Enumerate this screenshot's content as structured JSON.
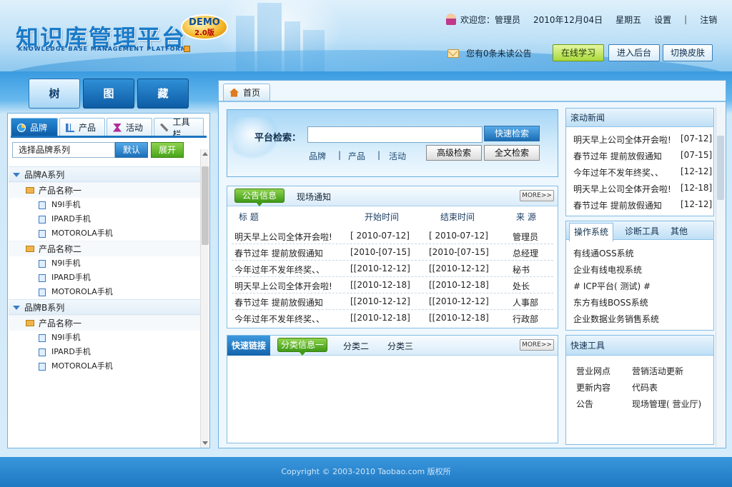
{
  "header": {
    "logo_title": "知识库管理平台",
    "logo_subtitle": "KNOWLEDGE BASE MANAGEMENT PLATFORM",
    "badge_demo": "DEMO",
    "badge_version": "2.0版",
    "welcome": "欢迎您：管理员",
    "date": "2010年12月04日",
    "weekday": "星期五",
    "settings": "设置",
    "separator": "|",
    "logout": "注销",
    "notice": "您有0条未读公告",
    "btn_learn": "在线学习",
    "btn_admin": "进入后台",
    "btn_skin": "切换皮肤"
  },
  "left": {
    "big_tabs": [
      "树",
      "图",
      "藏"
    ],
    "sub_tabs": [
      "品牌",
      "产品",
      "活动",
      "工具栏"
    ],
    "brand_select": "选择品牌系列",
    "btn_default": "默认",
    "btn_expand": "展开",
    "tree": [
      {
        "kind": "group",
        "label": "品牌A系列"
      },
      {
        "kind": "folder",
        "label": "产品名称一"
      },
      {
        "kind": "item",
        "label": "N9I手机"
      },
      {
        "kind": "item",
        "label": "IPARD手机"
      },
      {
        "kind": "item",
        "label": "MOTOROLA手机"
      },
      {
        "kind": "folder",
        "label": "产品名称二"
      },
      {
        "kind": "item",
        "label": "N9I手机"
      },
      {
        "kind": "item",
        "label": "IPARD手机"
      },
      {
        "kind": "item",
        "label": "MOTOROLA手机"
      },
      {
        "kind": "group",
        "label": "品牌B系列"
      },
      {
        "kind": "folder",
        "label": "产品名称一"
      },
      {
        "kind": "item",
        "label": "N9I手机"
      },
      {
        "kind": "item",
        "label": "IPARD手机"
      },
      {
        "kind": "item",
        "label": "MOTOROLA手机"
      }
    ]
  },
  "main": {
    "home_tab": "首页",
    "search": {
      "label": "平台检索：",
      "btn_quick": "快速检索",
      "btn_advanced": "高级检索",
      "btn_fulltext": "全文检索",
      "cats": [
        "品牌",
        "产品",
        "活动"
      ],
      "cat_sep": "|"
    },
    "notice_box": {
      "tab_active": "公告信息",
      "tab_other": "现场通知",
      "more": "MORE>>",
      "headers": [
        "标 题",
        "开始时间",
        "结束时间",
        "来 源"
      ],
      "rows": [
        [
          "明天早上公司全体开会啦!",
          "[ 2010-07-12]",
          "[ 2010-07-12]",
          "管理员"
        ],
        [
          "春节过年 提前放假通知",
          "[2010-[07-15]",
          "[2010-[07-15]",
          "总经理"
        ],
        [
          "今年过年不发年终奖、、",
          "[[2010-12-12]",
          "[[2010-12-12]",
          "秘书"
        ],
        [
          "明天早上公司全体开会啦!",
          "[[2010-12-18]",
          "[[2010-12-18]",
          "处长"
        ],
        [
          "春节过年 提前放假通知",
          "[[2010-12-12]",
          "[[2010-12-12]",
          "人事部"
        ],
        [
          "今年过年不发年终奖、、",
          "[[2010-12-18]",
          "[[2010-12-18]",
          "行政部"
        ]
      ]
    },
    "links_box": {
      "label": "快速链接",
      "tab_active": "分类信息一",
      "tab2": "分类二",
      "tab3": "分类三",
      "more": "MORE>>"
    }
  },
  "right": {
    "news": {
      "title": "滚动新闻",
      "items": [
        {
          "text": "明天早上公司全体开会啦!",
          "date": "[07-12]"
        },
        {
          "text": "春节过年 提前放假通知",
          "date": "[07-15]"
        },
        {
          "text": "今年过年不发年终奖、、",
          "date": "[12-12]"
        },
        {
          "text": "明天早上公司全体开会啦!",
          "date": "[12-18]"
        },
        {
          "text": "春节过年 提前放假通知",
          "date": "[12-12]"
        }
      ]
    },
    "ops": {
      "tabs": [
        "操作系统",
        "诊断工具",
        "其他"
      ],
      "items": [
        "有线通OSS系统",
        "企业有线电视系统",
        "# ICP平台( 测试) #",
        "东方有线BOSS系统",
        "企业数据业务销售系统"
      ]
    },
    "tools": {
      "title": "快速工具",
      "left": [
        "营业网点",
        "更新内容",
        "公告"
      ],
      "right": [
        "营销活动更新",
        "代码表",
        "现场管理( 营业厅)"
      ]
    }
  },
  "footer": {
    "copyright": "Copyright © 2003-2010 Taobao.com 版权所"
  }
}
